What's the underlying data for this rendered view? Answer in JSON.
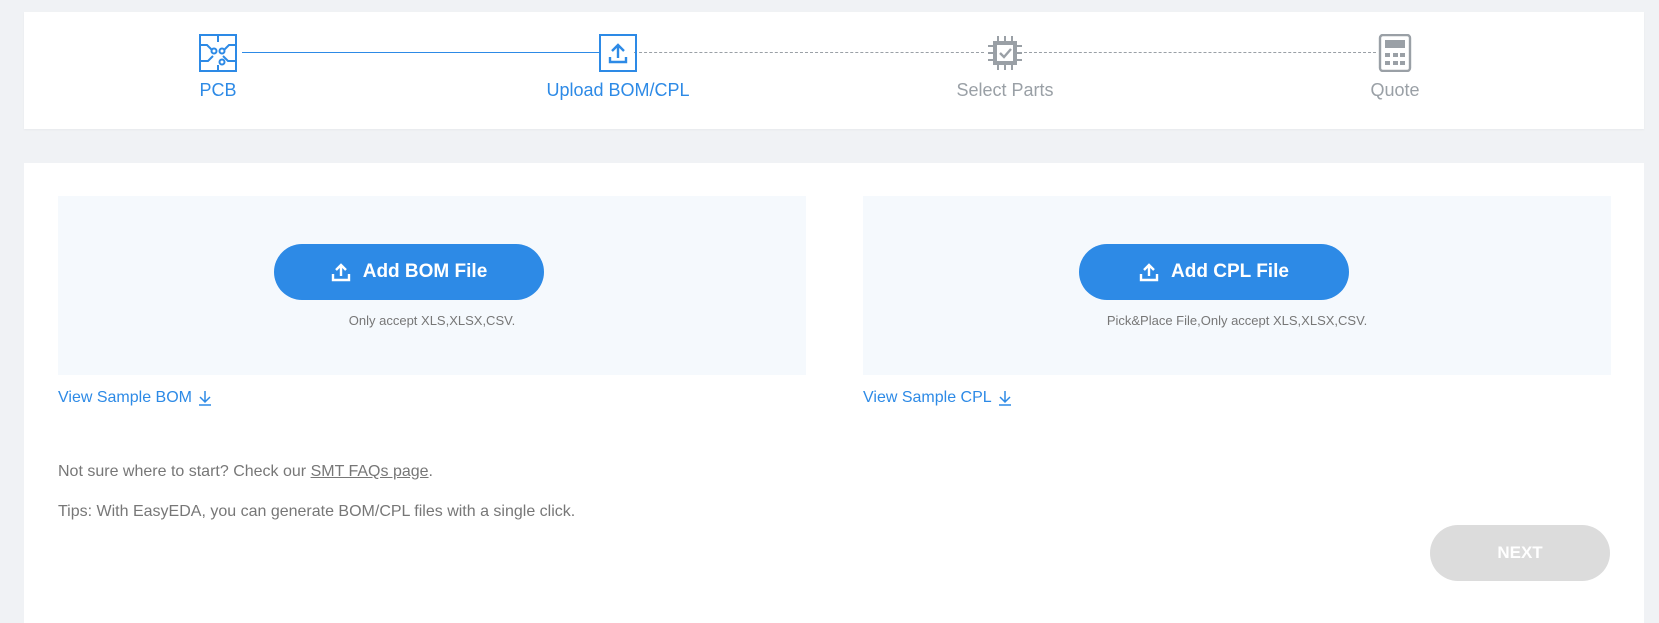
{
  "steps": [
    {
      "label": "PCB",
      "icon": "circuit-board-icon",
      "state": "done"
    },
    {
      "label": "Upload BOM/CPL",
      "icon": "upload-icon",
      "state": "active"
    },
    {
      "label": "Select Parts",
      "icon": "chip-check-icon",
      "state": "pending"
    },
    {
      "label": "Quote",
      "icon": "calculator-icon",
      "state": "pending"
    }
  ],
  "bom": {
    "button_label": "Add BOM File",
    "note": "Only accept XLS,XLSX,CSV.",
    "sample_link": "View Sample BOM"
  },
  "cpl": {
    "button_label": "Add CPL File",
    "note": "Pick&Place File,Only accept XLS,XLSX,CSV.",
    "sample_link": "View Sample CPL"
  },
  "help": {
    "prefix": "Not sure where to start? Check our ",
    "faq_link": "SMT FAQs page",
    "suffix": ".",
    "tips": "Tips: With EasyEDA, you can generate BOM/CPL files with a single click."
  },
  "next_label": "NEXT",
  "colors": {
    "accent": "#2d8ae6",
    "inactive": "#9aa0a6",
    "disabled_button": "#dcdcdc"
  }
}
